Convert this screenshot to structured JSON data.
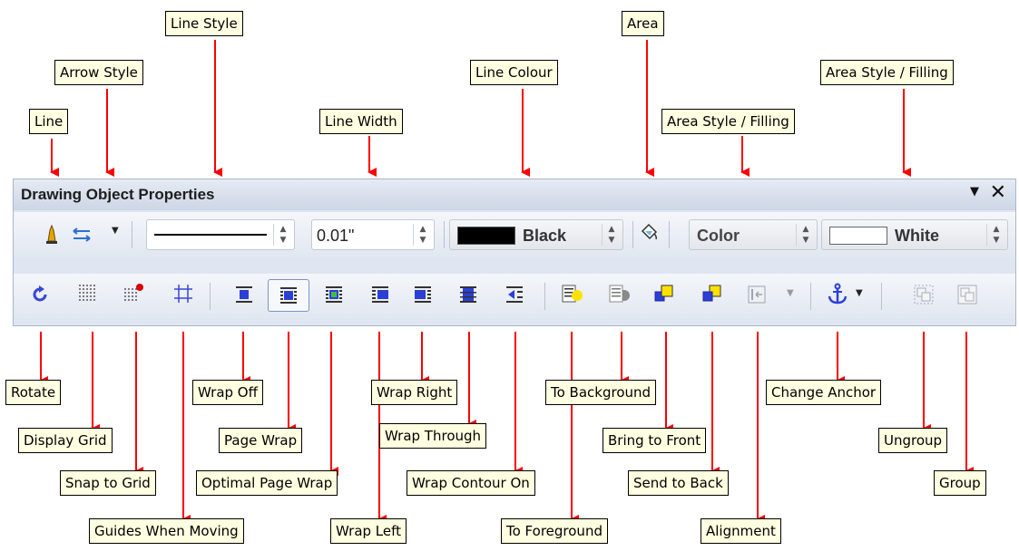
{
  "toolbar": {
    "title": "Drawing Object Properties",
    "line_width_value": "0.01\"",
    "line_colour_value": "Black",
    "area_style_value": "Color",
    "area_fill_value": "White"
  },
  "labels": {
    "line": "Line",
    "arrow_style": "Arrow Style",
    "line_style": "Line Style",
    "line_width": "Line Width",
    "line_colour": "Line Colour",
    "area": "Area",
    "area_style_filling_1": "Area Style / Filling",
    "area_style_filling_2": "Area Style / Filling",
    "rotate": "Rotate",
    "display_grid": "Display Grid",
    "snap_to_grid": "Snap to Grid",
    "guides_when_moving": "Guides When Moving",
    "wrap_off": "Wrap Off",
    "page_wrap": "Page Wrap",
    "optimal_page_wrap": "Optimal Page Wrap",
    "wrap_left": "Wrap Left",
    "wrap_right": "Wrap Right",
    "wrap_through": "Wrap Through",
    "wrap_contour_on": "Wrap Contour On",
    "to_background": "To Background",
    "to_foreground": "To Foreground",
    "bring_to_front": "Bring to Front",
    "send_to_back": "Send to Back",
    "alignment": "Alignment",
    "change_anchor": "Change Anchor",
    "ungroup": "Ungroup",
    "group": "Group"
  },
  "colors": {
    "callout_background": "#ffffe1",
    "arrow": "#ff0000",
    "toolbar_background": "#dfe6f2",
    "icon_blue": "#2b3fd6",
    "icon_yellow": "#ffe100"
  },
  "icons": [
    "line-icon",
    "arrow-style-icon",
    "rotate-icon",
    "display-grid-icon",
    "snap-to-grid-icon",
    "guides-icon",
    "wrap-off-icon",
    "page-wrap-icon",
    "optimal-page-wrap-icon",
    "wrap-left-icon",
    "wrap-right-icon",
    "wrap-through-icon",
    "wrap-contour-icon",
    "to-foreground-icon",
    "to-background-icon",
    "bring-to-front-icon",
    "send-to-back-icon",
    "alignment-icon",
    "anchor-icon",
    "ungroup-icon",
    "group-icon",
    "area-icon"
  ]
}
